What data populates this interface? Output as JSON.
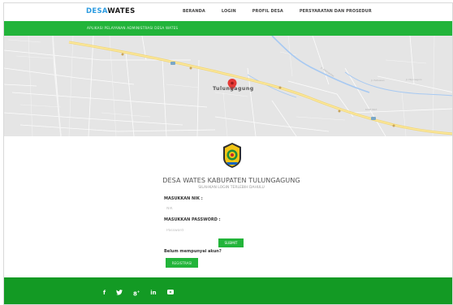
{
  "brand": {
    "part1": "DESA",
    "part2": "WATES"
  },
  "nav": [
    {
      "label": "BERANDA"
    },
    {
      "label": "LOGIN"
    },
    {
      "label": "PROFIL DESA"
    },
    {
      "label": "PERSYARATAN DAN PROSEDUR"
    }
  ],
  "subheader": "APLIKASI PELAYANAN ADMINISTRASI DESA WATES",
  "map": {
    "city_label": "Tulungagung"
  },
  "login": {
    "title": "DESA WATES KABUPATEN TULUNGAGUNG",
    "subtitle": "SILAHKAN LOGIN TERLEBIH DAHULU",
    "nik_label": "MASUKKAN NIK :",
    "nik_placeholder": "NIK",
    "password_label": "MASUKKAN PASSWORD :",
    "password_placeholder": "Password",
    "submit_label": "SUBMIT",
    "no_account_text": "Belum mempunyai akun?",
    "register_label": "REGISTRASI"
  },
  "footer": {
    "social": [
      {
        "icon": "facebook-icon",
        "glyph": "f"
      },
      {
        "icon": "twitter-icon",
        "glyph": "🐦"
      },
      {
        "icon": "google-plus-icon",
        "glyph": "8⁺"
      },
      {
        "icon": "linkedin-icon",
        "glyph": "in"
      },
      {
        "icon": "youtube-icon",
        "glyph": ""
      }
    ]
  },
  "colors": {
    "green": "#22b43a",
    "footer_green": "#139a24",
    "brand_blue": "#2b9be0",
    "map_pin": "#e53935"
  }
}
